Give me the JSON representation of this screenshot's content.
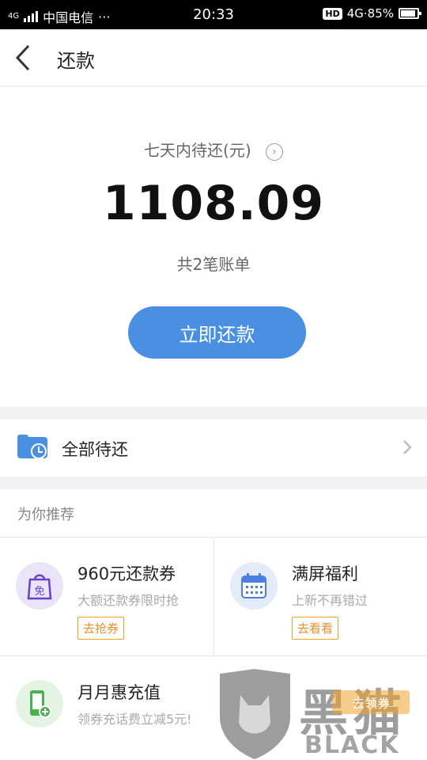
{
  "status_bar": {
    "network": "4G",
    "carrier": "中国电信",
    "more": "···",
    "time": "20:33",
    "hd": "HD",
    "battery": "4G⋅85%"
  },
  "header": {
    "title": "还款"
  },
  "summary": {
    "due_label": "七天内待还(元)",
    "amount": "1108.09",
    "bill_count": "共2笔账单",
    "pay_button": "立即还款"
  },
  "pending": {
    "label": "全部待还"
  },
  "recommend": {
    "header": "为你推荐",
    "items": [
      {
        "title": "960元还款券",
        "subtitle": "大额还款券限时抢",
        "tag": "去抢券",
        "icon": "voucher-bag-icon"
      },
      {
        "title": "满屏福利",
        "subtitle": "上新不再错过",
        "tag": "去看看",
        "icon": "calendar-icon"
      },
      {
        "title": "月月惠充值",
        "subtitle": "领券充话费立减5元!",
        "tag": "",
        "icon": "phone-recharge-icon"
      }
    ]
  },
  "watermark": {
    "cn": "黑猫",
    "en": "BLACK CAT",
    "pill": "去领券"
  },
  "colors": {
    "primary": "#4a90e2",
    "tag": "#e8902c",
    "voucher_bg": "#e9e4f7",
    "calendar_bg": "#e4ebf8",
    "phone_bg": "#e4f3e4"
  }
}
